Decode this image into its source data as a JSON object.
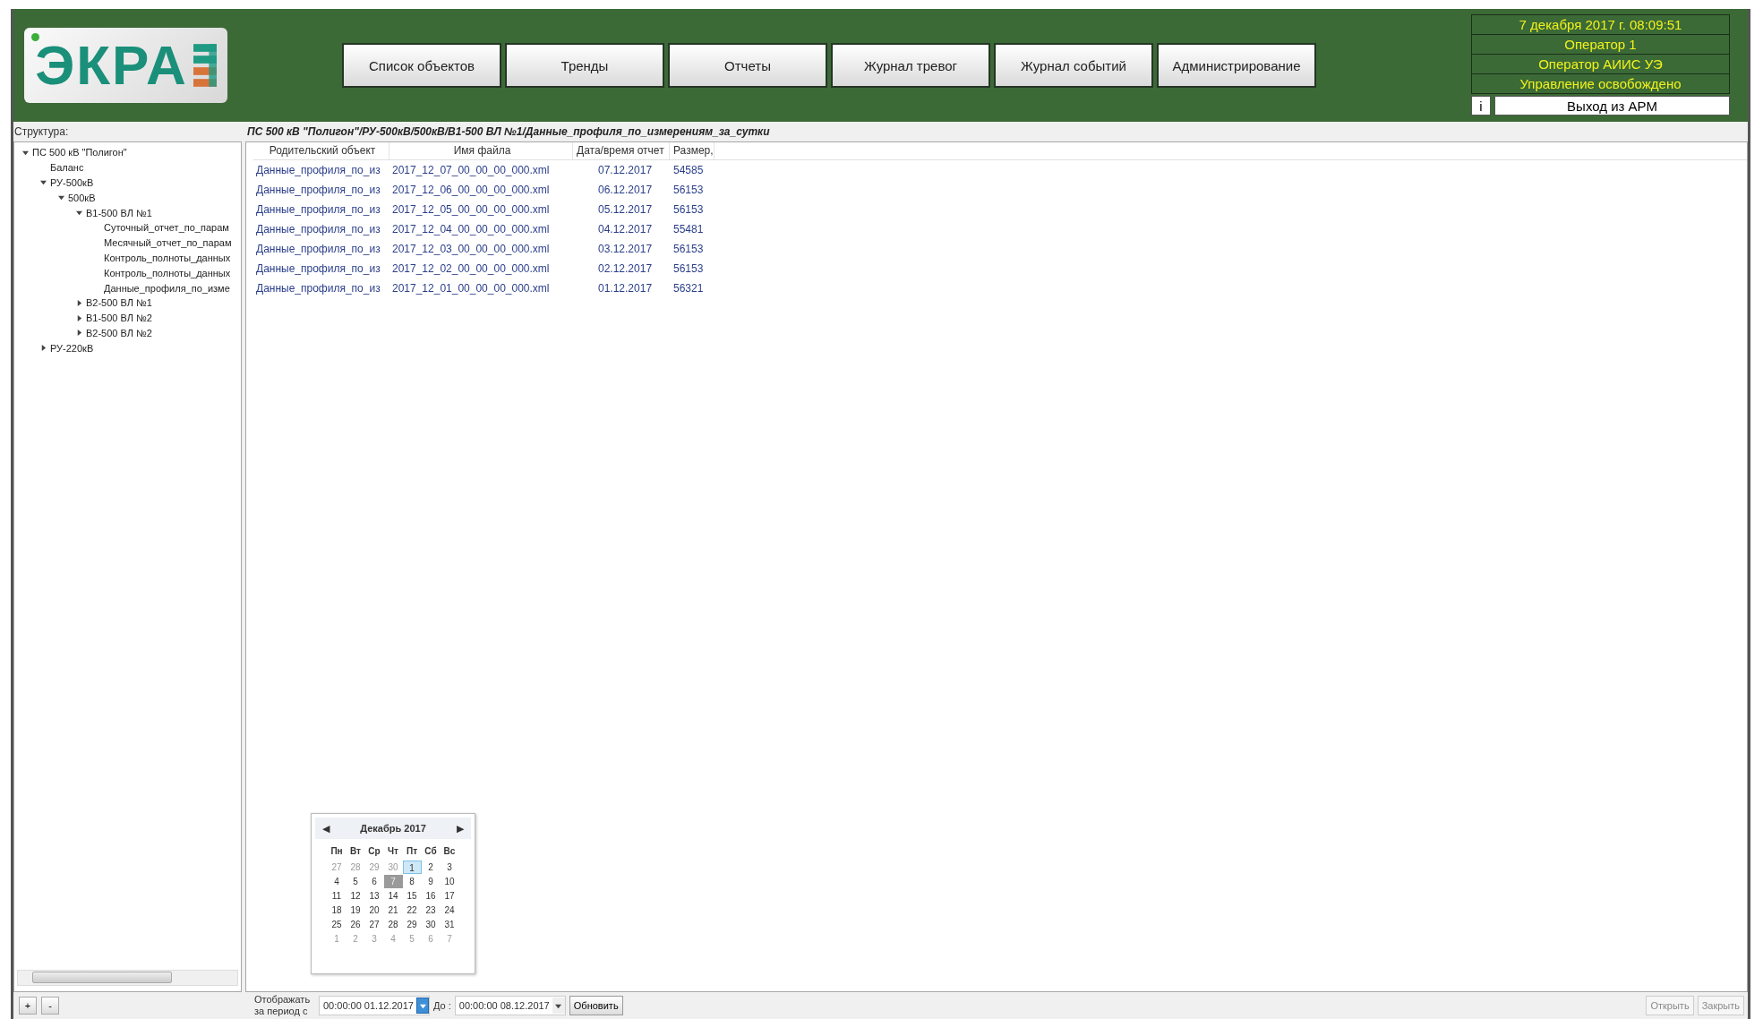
{
  "logo": {
    "text": "ЭКРА"
  },
  "nav": [
    {
      "label": "Список объектов",
      "selected": false
    },
    {
      "label": "Тренды",
      "selected": false
    },
    {
      "label": "Отчеты",
      "selected": false
    },
    {
      "label": "Журнал тревог",
      "selected": false
    },
    {
      "label": "Журнал событий",
      "selected": false
    },
    {
      "label": "Администрирование",
      "selected": false
    }
  ],
  "status": {
    "datetime": "7 декабря 2017 г. 08:09:51",
    "operator": "Оператор 1",
    "role": "Оператор АИИС УЭ",
    "control": "Управление освобождено",
    "info_button": "i",
    "exit_button": "Выход из АРМ"
  },
  "sidebar": {
    "title": "Структура:",
    "tree": [
      {
        "label": "ПС 500 кВ \"Полигон\"",
        "expanded": true,
        "children": [
          {
            "label": "Баланс"
          },
          {
            "label": "РУ-500кВ",
            "expanded": true,
            "children": [
              {
                "label": "500кВ",
                "expanded": true,
                "children": [
                  {
                    "label": "В1-500 ВЛ №1",
                    "expanded": true,
                    "children": [
                      {
                        "label": "Суточный_отчет_по_парам"
                      },
                      {
                        "label": "Месячный_отчет_по_парам"
                      },
                      {
                        "label": "Контроль_полноты_данных"
                      },
                      {
                        "label": "Контроль_полноты_данных"
                      },
                      {
                        "label": "Данные_профиля_по_изме"
                      }
                    ]
                  },
                  {
                    "label": "В2-500 ВЛ №1",
                    "expanded": false
                  },
                  {
                    "label": "В1-500 ВЛ №2",
                    "expanded": false
                  },
                  {
                    "label": "В2-500 ВЛ №2",
                    "expanded": false
                  }
                ]
              }
            ]
          },
          {
            "label": "РУ-220кВ",
            "expanded": false
          }
        ]
      }
    ],
    "buttons": [
      "+",
      "-"
    ]
  },
  "content": {
    "path": "ПС 500 кВ \"Полигон\"/РУ-500кВ/500кВ/В1-500 ВЛ №1/Данные_профиля_по_измерениям_за_сутки",
    "table": {
      "columns": [
        "Родительский объект",
        "Имя файла",
        "Дата/время отчет",
        "Размер,"
      ],
      "rows": [
        [
          "Данные_профиля_по_из",
          "2017_12_07_00_00_00_000.xml",
          "07.12.2017",
          "54585"
        ],
        [
          "Данные_профиля_по_из",
          "2017_12_06_00_00_00_000.xml",
          "06.12.2017",
          "56153"
        ],
        [
          "Данные_профиля_по_из",
          "2017_12_05_00_00_00_000.xml",
          "05.12.2017",
          "56153"
        ],
        [
          "Данные_профиля_по_из",
          "2017_12_04_00_00_00_000.xml",
          "04.12.2017",
          "55481"
        ],
        [
          "Данные_профиля_по_из",
          "2017_12_03_00_00_00_000.xml",
          "03.12.2017",
          "56153"
        ],
        [
          "Данные_профиля_по_из",
          "2017_12_02_00_00_00_000.xml",
          "02.12.2017",
          "56153"
        ],
        [
          "Данные_профиля_по_из",
          "2017_12_01_00_00_00_000.xml",
          "01.12.2017",
          "56321"
        ]
      ]
    }
  },
  "calendar": {
    "month": "Декабрь 2017",
    "prev": "◀",
    "next": "▶",
    "weekdays": [
      "Пн",
      "Вт",
      "Ср",
      "Чт",
      "Пт",
      "Сб",
      "Вс"
    ],
    "days": [
      {
        "label": "27",
        "other_month": true,
        "selected": false,
        "today": false
      },
      {
        "label": "28",
        "other_month": true,
        "selected": false,
        "today": false
      },
      {
        "label": "29",
        "other_month": true,
        "selected": false,
        "today": false
      },
      {
        "label": "30",
        "other_month": true,
        "selected": false,
        "today": false
      },
      {
        "label": "1",
        "other_month": false,
        "selected": true,
        "today": false
      },
      {
        "label": "2",
        "other_month": false,
        "selected": false,
        "today": false
      },
      {
        "label": "3",
        "other_month": false,
        "selected": false,
        "today": false
      },
      {
        "label": "4",
        "other_month": false,
        "selected": false,
        "today": false
      },
      {
        "label": "5",
        "other_month": false,
        "selected": false,
        "today": false
      },
      {
        "label": "6",
        "other_month": false,
        "selected": false,
        "today": false
      },
      {
        "label": "7",
        "other_month": false,
        "selected": false,
        "today": true
      },
      {
        "label": "8",
        "other_month": false,
        "selected": false,
        "today": false
      },
      {
        "label": "9",
        "other_month": false,
        "selected": false,
        "today": false
      },
      {
        "label": "10",
        "other_month": false,
        "selected": false,
        "today": false
      },
      {
        "label": "11",
        "other_month": false,
        "selected": false,
        "today": false
      },
      {
        "label": "12",
        "other_month": false,
        "selected": false,
        "today": false
      },
      {
        "label": "13",
        "other_month": false,
        "selected": false,
        "today": false
      },
      {
        "label": "14",
        "other_month": false,
        "selected": false,
        "today": false
      },
      {
        "label": "15",
        "other_month": false,
        "selected": false,
        "today": false
      },
      {
        "label": "16",
        "other_month": false,
        "selected": false,
        "today": false
      },
      {
        "label": "17",
        "other_month": false,
        "selected": false,
        "today": false
      },
      {
        "label": "18",
        "other_month": false,
        "selected": false,
        "today": false
      },
      {
        "label": "19",
        "other_month": false,
        "selected": false,
        "today": false
      },
      {
        "label": "20",
        "other_month": false,
        "selected": false,
        "today": false
      },
      {
        "label": "21",
        "other_month": false,
        "selected": false,
        "today": false
      },
      {
        "label": "22",
        "other_month": false,
        "selected": false,
        "today": false
      },
      {
        "label": "23",
        "other_month": false,
        "selected": false,
        "today": false
      },
      {
        "label": "24",
        "other_month": false,
        "selected": false,
        "today": false
      },
      {
        "label": "25",
        "other_month": false,
        "selected": false,
        "today": false
      },
      {
        "label": "26",
        "other_month": false,
        "selected": false,
        "today": false
      },
      {
        "label": "27",
        "other_month": false,
        "selected": false,
        "today": false
      },
      {
        "label": "28",
        "other_month": false,
        "selected": false,
        "today": false
      },
      {
        "label": "29",
        "other_month": false,
        "selected": false,
        "today": false
      },
      {
        "label": "30",
        "other_month": false,
        "selected": false,
        "today": false
      },
      {
        "label": "31",
        "other_month": false,
        "selected": false,
        "today": false
      },
      {
        "label": "1",
        "other_month": true,
        "selected": false,
        "today": false
      },
      {
        "label": "2",
        "other_month": true,
        "selected": false,
        "today": false
      },
      {
        "label": "3",
        "other_month": true,
        "selected": false,
        "today": false
      },
      {
        "label": "4",
        "other_month": true,
        "selected": false,
        "today": false
      },
      {
        "label": "5",
        "other_month": true,
        "selected": false,
        "today": false
      },
      {
        "label": "6",
        "other_month": true,
        "selected": false,
        "today": false
      },
      {
        "label": "7",
        "other_month": true,
        "selected": false,
        "today": false
      }
    ]
  },
  "period": {
    "label": "Отображать за период с",
    "from": {
      "value": "00:00:00 01.12.2017",
      "open": true
    },
    "to_label": "До :",
    "to": {
      "value": "00:00:00 08.12.2017",
      "open": false
    },
    "refresh": "Обновить"
  },
  "actions": [
    {
      "label": "Открыть",
      "disabled": true
    },
    {
      "label": "Закрыть",
      "disabled": true
    }
  ]
}
